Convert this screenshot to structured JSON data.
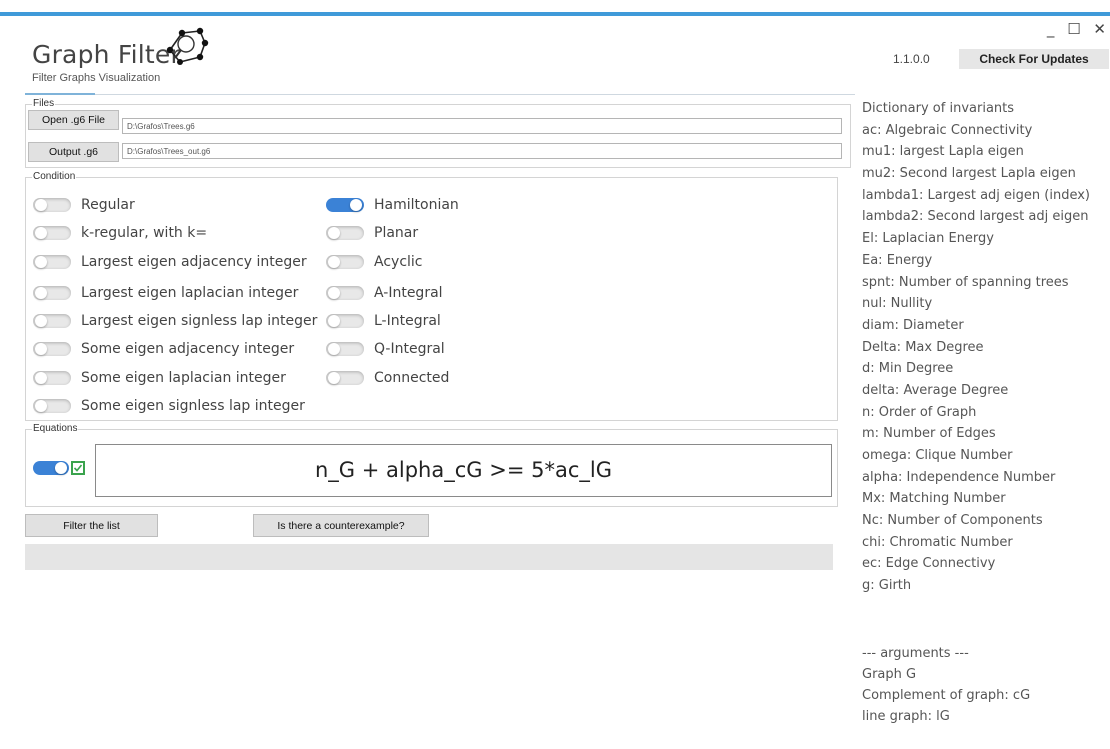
{
  "window": {
    "minimize": "_",
    "maximize": "☐",
    "close": "✕"
  },
  "header": {
    "title": "Graph Filter",
    "subtitle": "Filter Graphs Visualization",
    "version": "1.1.0.0",
    "update_button": "Check For Updates"
  },
  "files": {
    "legend": "Files",
    "open_button": "Open .g6 File",
    "open_path": "D:\\Grafos\\Trees.g6",
    "output_button": "Output .g6",
    "output_path": "D:\\Grafos\\Trees_out.g6"
  },
  "condition": {
    "legend": "Condition",
    "left": [
      {
        "label": "Regular",
        "on": false
      },
      {
        "label": "k-regular, with k=",
        "on": false
      },
      {
        "label": "Largest eigen adjacency integer",
        "on": false
      },
      {
        "label": "Largest eigen laplacian integer",
        "on": false
      },
      {
        "label": "Largest eigen signless lap integer",
        "on": false
      },
      {
        "label": "Some eigen adjacency integer",
        "on": false
      },
      {
        "label": "Some eigen laplacian integer",
        "on": false
      },
      {
        "label": "Some eigen signless lap integer",
        "on": false
      }
    ],
    "right": [
      {
        "label": "Hamiltonian",
        "on": true
      },
      {
        "label": "Planar",
        "on": false
      },
      {
        "label": "Acyclic",
        "on": false
      },
      {
        "label": "A-Integral",
        "on": false
      },
      {
        "label": "L-Integral",
        "on": false
      },
      {
        "label": "Q-Integral",
        "on": false
      },
      {
        "label": "Connected",
        "on": false
      }
    ]
  },
  "equations": {
    "legend": "Equations",
    "toggle_on": true,
    "checked": true,
    "expression": "n_G + alpha_cG >= 5*ac_lG"
  },
  "actions": {
    "filter_button": "Filter the list",
    "counterexample_button": "Is there a counterexample?"
  },
  "dictionary": {
    "title": "Dictionary of invariants",
    "items": [
      "ac: Algebraic Connectivity",
      "mu1: largest Lapla eigen",
      "mu2: Second largest Lapla eigen",
      "lambda1: Largest adj eigen (index)",
      "lambda2: Second largest adj eigen",
      "El: Laplacian Energy",
      "Ea: Energy",
      "spnt: Number of spanning trees",
      "nul: Nullity",
      "diam: Diameter",
      "Delta: Max Degree",
      "d: Min Degree",
      "delta: Average Degree",
      "n: Order of Graph",
      "m: Number of Edges",
      "omega: Clique Number",
      "alpha: Independence Number",
      "Mx: Matching Number",
      "Nc: Number of Components",
      "chi: Chromatic Number",
      "ec: Edge Connectivy",
      "g: Girth"
    ],
    "arguments_title": "--- arguments ---",
    "arguments": [
      "Graph G",
      "Complement of graph: cG",
      "line graph: lG"
    ]
  },
  "colors": {
    "accent": "#3f9ad9",
    "toggle_on": "#3b82d6",
    "checkbox": "#3aa34d"
  }
}
